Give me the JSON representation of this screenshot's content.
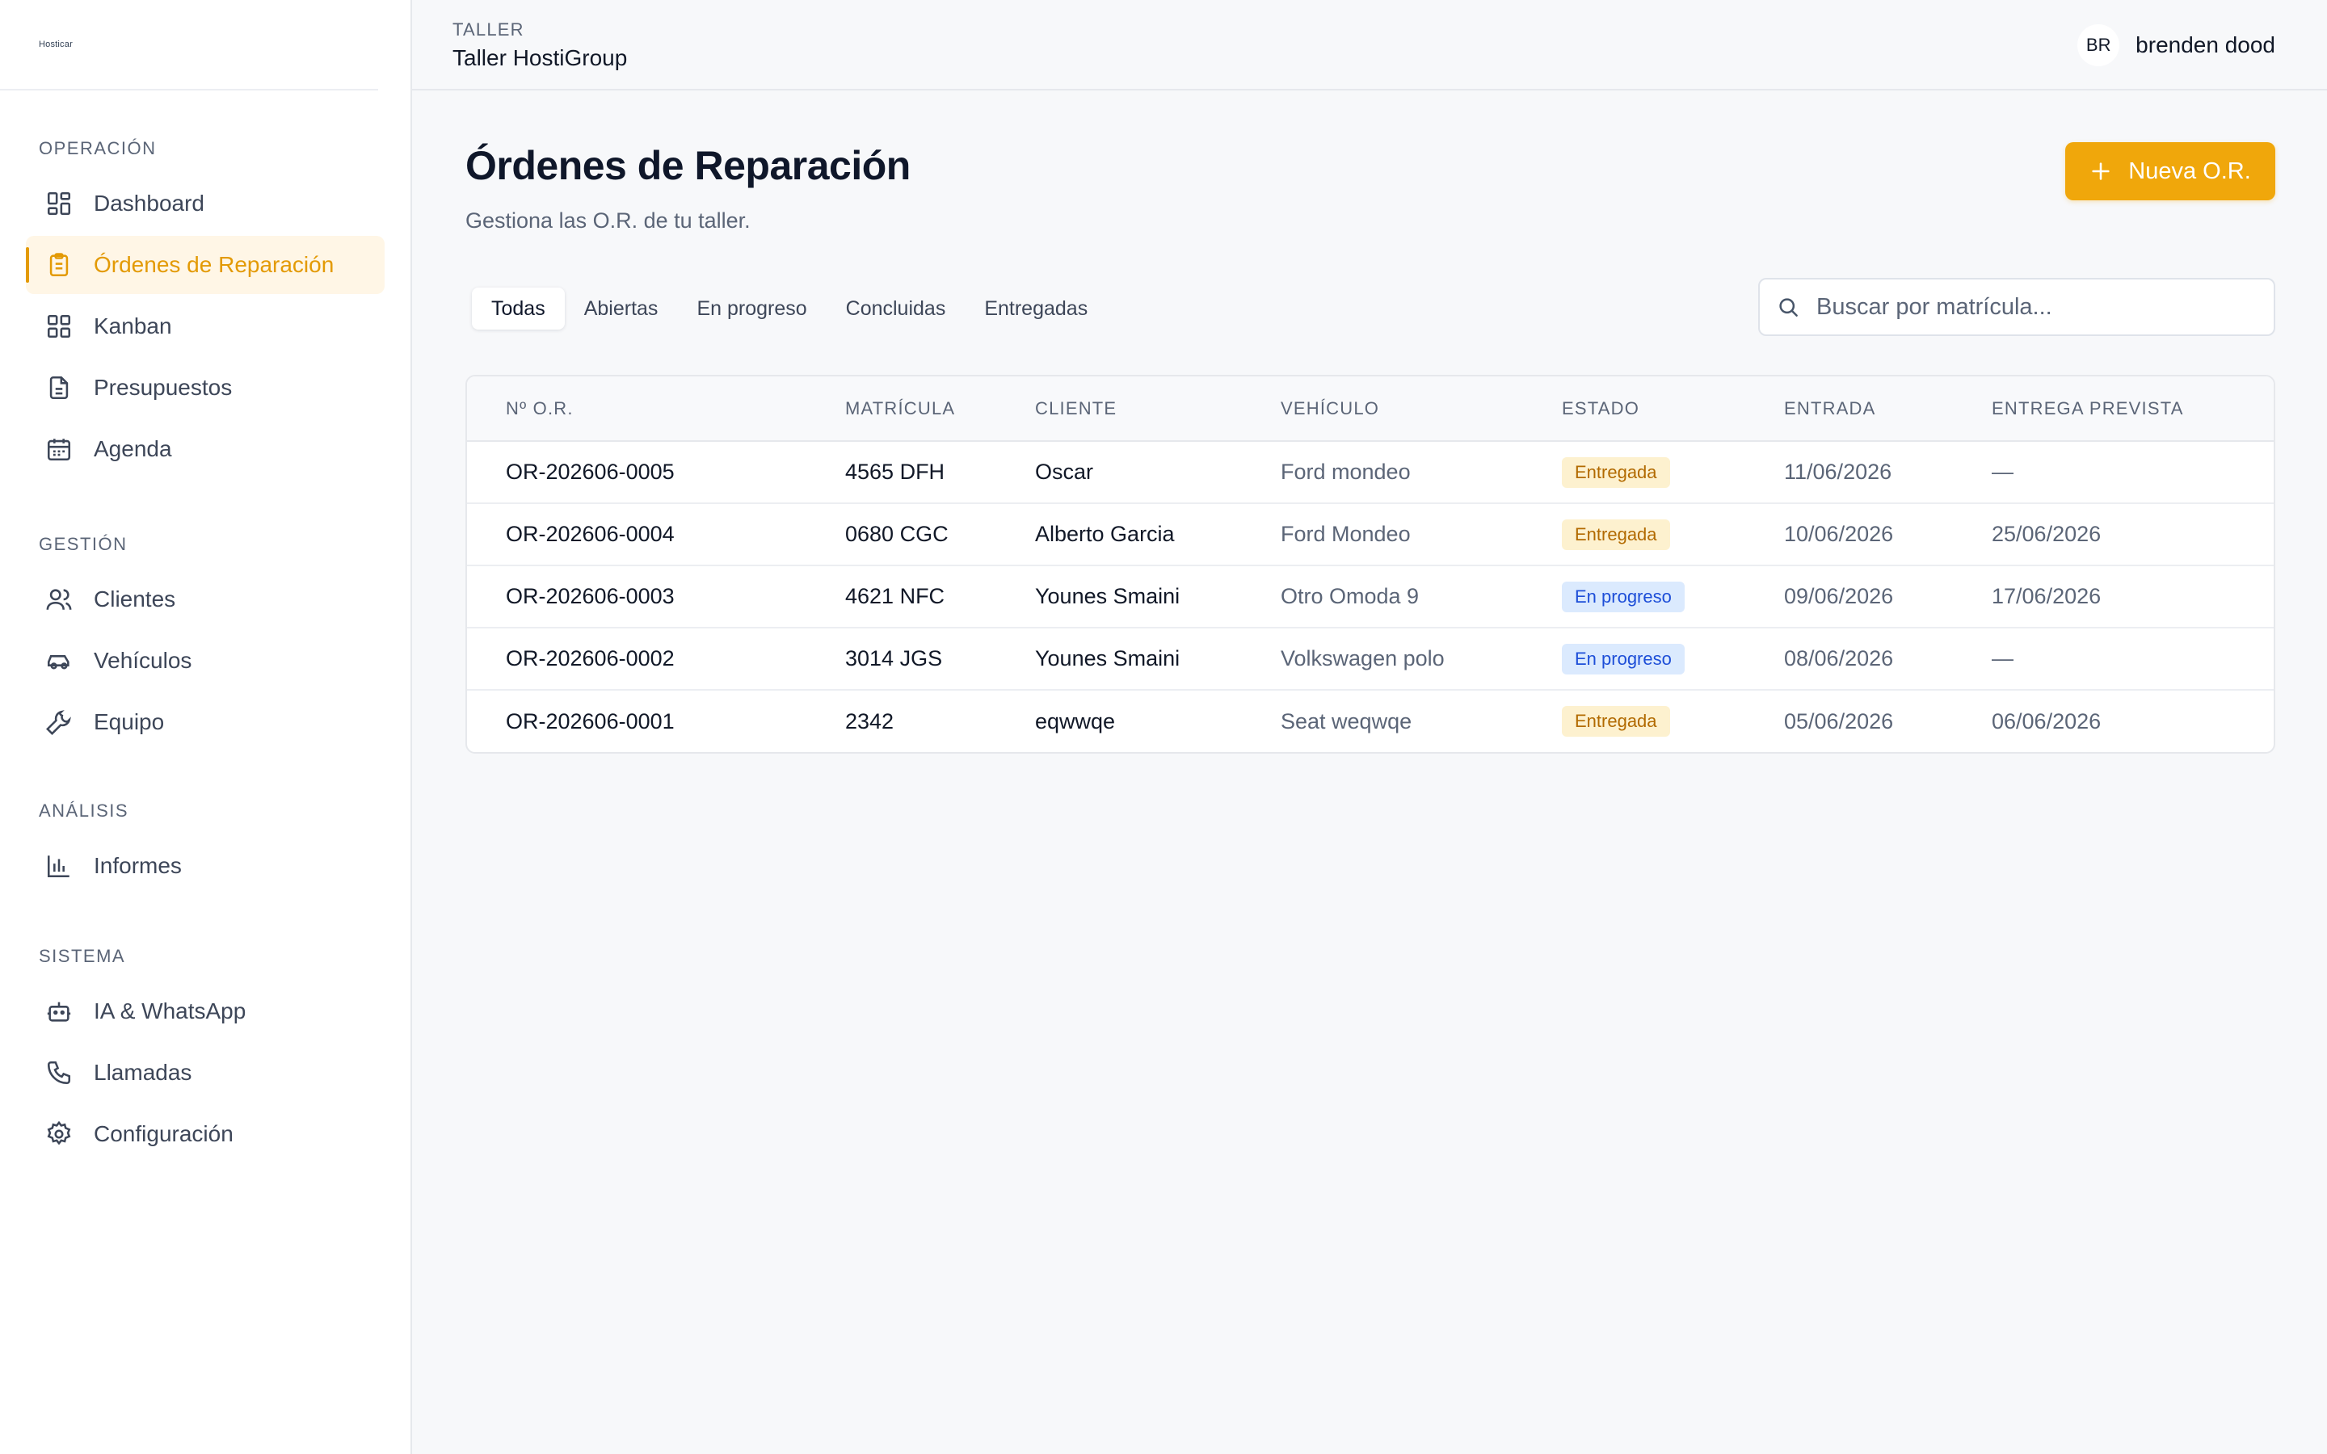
{
  "brand": {
    "logo_text": "Hosticar"
  },
  "sidebar": {
    "sections": [
      {
        "heading": "OPERACIÓN",
        "items": [
          {
            "label": "Dashboard",
            "icon": "dashboard-icon"
          },
          {
            "label": "Órdenes de Reparación",
            "icon": "clipboard-icon",
            "active": true
          },
          {
            "label": "Kanban",
            "icon": "kanban-icon"
          },
          {
            "label": "Presupuestos",
            "icon": "document-icon"
          },
          {
            "label": "Agenda",
            "icon": "calendar-icon"
          }
        ]
      },
      {
        "heading": "GESTIÓN",
        "items": [
          {
            "label": "Clientes",
            "icon": "users-icon"
          },
          {
            "label": "Vehículos",
            "icon": "car-icon"
          },
          {
            "label": "Equipo",
            "icon": "wrench-icon"
          }
        ]
      },
      {
        "heading": "ANÁLISIS",
        "items": [
          {
            "label": "Informes",
            "icon": "bar-chart-icon"
          }
        ]
      },
      {
        "heading": "SISTEMA",
        "items": [
          {
            "label": "IA & WhatsApp",
            "icon": "bot-icon"
          },
          {
            "label": "Llamadas",
            "icon": "phone-icon"
          },
          {
            "label": "Configuración",
            "icon": "gear-icon"
          }
        ]
      }
    ]
  },
  "topbar": {
    "workspace_label": "TALLER",
    "workspace_name": "Taller HostiGroup",
    "user_initials": "BR",
    "user_name": "brenden dood"
  },
  "page": {
    "title": "Órdenes de Reparación",
    "subtitle": "Gestiona las O.R. de tu taller.",
    "new_button": "Nueva O.R."
  },
  "tabs": [
    {
      "label": "Todas",
      "active": true
    },
    {
      "label": "Abiertas"
    },
    {
      "label": "En progreso"
    },
    {
      "label": "Concluidas"
    },
    {
      "label": "Entregadas"
    }
  ],
  "search": {
    "placeholder": "Buscar por matrícula...",
    "value": ""
  },
  "table": {
    "columns": [
      "Nº O.R.",
      "MATRÍCULA",
      "CLIENTE",
      "VEHÍCULO",
      "ESTADO",
      "ENTRADA",
      "ENTREGA PREVISTA"
    ],
    "rows": [
      {
        "numero": "OR-202606-0005",
        "matricula": "4565 DFH",
        "cliente": "Oscar",
        "vehiculo": "Ford mondeo",
        "estado": "Entregada",
        "estado_tipo": "entregada",
        "entrada": "11/06/2026",
        "entrega": "—"
      },
      {
        "numero": "OR-202606-0004",
        "matricula": "0680 CGC",
        "cliente": "Alberto Garcia",
        "vehiculo": "Ford Mondeo",
        "estado": "Entregada",
        "estado_tipo": "entregada",
        "entrada": "10/06/2026",
        "entrega": "25/06/2026"
      },
      {
        "numero": "OR-202606-0003",
        "matricula": "4621 NFC",
        "cliente": "Younes Smaini",
        "vehiculo": "Otro Omoda 9",
        "estado": "En progreso",
        "estado_tipo": "progreso",
        "entrada": "09/06/2026",
        "entrega": "17/06/2026"
      },
      {
        "numero": "OR-202606-0002",
        "matricula": "3014 JGS",
        "cliente": "Younes Smaini",
        "vehiculo": "Volkswagen polo",
        "estado": "En progreso",
        "estado_tipo": "progreso",
        "entrada": "08/06/2026",
        "entrega": "—"
      },
      {
        "numero": "OR-202606-0001",
        "matricula": "2342",
        "cliente": "eqwwqe",
        "vehiculo": "Seat weqwqe",
        "estado": "Entregada",
        "estado_tipo": "entregada",
        "entrada": "05/06/2026",
        "entrega": "06/06/2026"
      }
    ]
  },
  "colors": {
    "accent": "#f0a70b",
    "accent_text": "#e39a05",
    "badge_entregada_bg": "#fdf1cf",
    "badge_progreso_bg": "#dbeafe"
  }
}
